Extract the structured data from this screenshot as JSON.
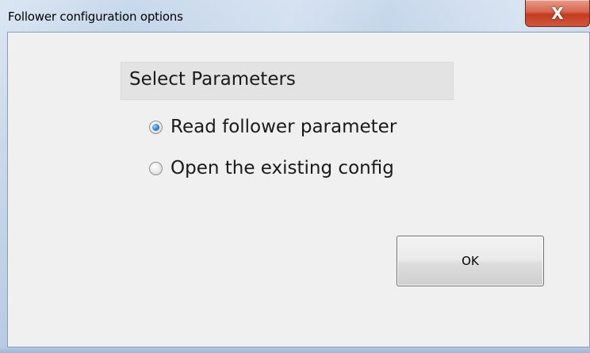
{
  "window": {
    "title": "Follower configuration options",
    "close_icon": "close-icon"
  },
  "group": {
    "label": "Select Parameters"
  },
  "options": [
    {
      "label": "Read follower parameter",
      "checked": true
    },
    {
      "label": "Open the existing config",
      "checked": false
    }
  ],
  "buttons": {
    "ok_label": "OK",
    "close_glyph": "X"
  },
  "colors": {
    "close_red": "#c43b20",
    "radio_selected": "#2d7fd2",
    "client_bg": "#f0f0f0"
  }
}
